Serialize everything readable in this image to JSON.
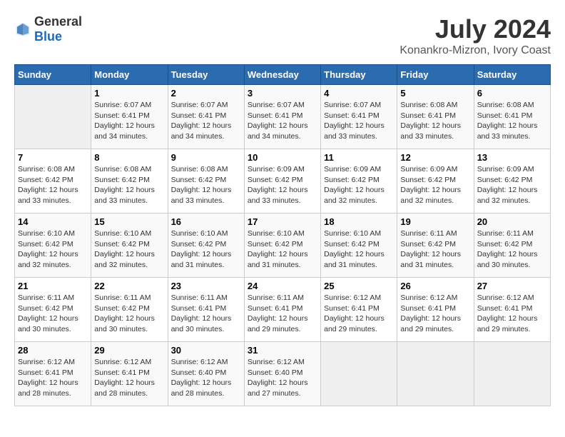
{
  "header": {
    "logo_general": "General",
    "logo_blue": "Blue",
    "month_year": "July 2024",
    "location": "Konankro-Mizron, Ivory Coast"
  },
  "weekdays": [
    "Sunday",
    "Monday",
    "Tuesday",
    "Wednesday",
    "Thursday",
    "Friday",
    "Saturday"
  ],
  "weeks": [
    [
      {
        "day": "",
        "sunrise": "",
        "sunset": "",
        "daylight": ""
      },
      {
        "day": "1",
        "sunrise": "Sunrise: 6:07 AM",
        "sunset": "Sunset: 6:41 PM",
        "daylight": "Daylight: 12 hours and 34 minutes."
      },
      {
        "day": "2",
        "sunrise": "Sunrise: 6:07 AM",
        "sunset": "Sunset: 6:41 PM",
        "daylight": "Daylight: 12 hours and 34 minutes."
      },
      {
        "day": "3",
        "sunrise": "Sunrise: 6:07 AM",
        "sunset": "Sunset: 6:41 PM",
        "daylight": "Daylight: 12 hours and 34 minutes."
      },
      {
        "day": "4",
        "sunrise": "Sunrise: 6:07 AM",
        "sunset": "Sunset: 6:41 PM",
        "daylight": "Daylight: 12 hours and 33 minutes."
      },
      {
        "day": "5",
        "sunrise": "Sunrise: 6:08 AM",
        "sunset": "Sunset: 6:41 PM",
        "daylight": "Daylight: 12 hours and 33 minutes."
      },
      {
        "day": "6",
        "sunrise": "Sunrise: 6:08 AM",
        "sunset": "Sunset: 6:41 PM",
        "daylight": "Daylight: 12 hours and 33 minutes."
      }
    ],
    [
      {
        "day": "7",
        "sunrise": "Sunrise: 6:08 AM",
        "sunset": "Sunset: 6:42 PM",
        "daylight": "Daylight: 12 hours and 33 minutes."
      },
      {
        "day": "8",
        "sunrise": "Sunrise: 6:08 AM",
        "sunset": "Sunset: 6:42 PM",
        "daylight": "Daylight: 12 hours and 33 minutes."
      },
      {
        "day": "9",
        "sunrise": "Sunrise: 6:08 AM",
        "sunset": "Sunset: 6:42 PM",
        "daylight": "Daylight: 12 hours and 33 minutes."
      },
      {
        "day": "10",
        "sunrise": "Sunrise: 6:09 AM",
        "sunset": "Sunset: 6:42 PM",
        "daylight": "Daylight: 12 hours and 33 minutes."
      },
      {
        "day": "11",
        "sunrise": "Sunrise: 6:09 AM",
        "sunset": "Sunset: 6:42 PM",
        "daylight": "Daylight: 12 hours and 32 minutes."
      },
      {
        "day": "12",
        "sunrise": "Sunrise: 6:09 AM",
        "sunset": "Sunset: 6:42 PM",
        "daylight": "Daylight: 12 hours and 32 minutes."
      },
      {
        "day": "13",
        "sunrise": "Sunrise: 6:09 AM",
        "sunset": "Sunset: 6:42 PM",
        "daylight": "Daylight: 12 hours and 32 minutes."
      }
    ],
    [
      {
        "day": "14",
        "sunrise": "Sunrise: 6:10 AM",
        "sunset": "Sunset: 6:42 PM",
        "daylight": "Daylight: 12 hours and 32 minutes."
      },
      {
        "day": "15",
        "sunrise": "Sunrise: 6:10 AM",
        "sunset": "Sunset: 6:42 PM",
        "daylight": "Daylight: 12 hours and 32 minutes."
      },
      {
        "day": "16",
        "sunrise": "Sunrise: 6:10 AM",
        "sunset": "Sunset: 6:42 PM",
        "daylight": "Daylight: 12 hours and 31 minutes."
      },
      {
        "day": "17",
        "sunrise": "Sunrise: 6:10 AM",
        "sunset": "Sunset: 6:42 PM",
        "daylight": "Daylight: 12 hours and 31 minutes."
      },
      {
        "day": "18",
        "sunrise": "Sunrise: 6:10 AM",
        "sunset": "Sunset: 6:42 PM",
        "daylight": "Daylight: 12 hours and 31 minutes."
      },
      {
        "day": "19",
        "sunrise": "Sunrise: 6:11 AM",
        "sunset": "Sunset: 6:42 PM",
        "daylight": "Daylight: 12 hours and 31 minutes."
      },
      {
        "day": "20",
        "sunrise": "Sunrise: 6:11 AM",
        "sunset": "Sunset: 6:42 PM",
        "daylight": "Daylight: 12 hours and 30 minutes."
      }
    ],
    [
      {
        "day": "21",
        "sunrise": "Sunrise: 6:11 AM",
        "sunset": "Sunset: 6:42 PM",
        "daylight": "Daylight: 12 hours and 30 minutes."
      },
      {
        "day": "22",
        "sunrise": "Sunrise: 6:11 AM",
        "sunset": "Sunset: 6:42 PM",
        "daylight": "Daylight: 12 hours and 30 minutes."
      },
      {
        "day": "23",
        "sunrise": "Sunrise: 6:11 AM",
        "sunset": "Sunset: 6:41 PM",
        "daylight": "Daylight: 12 hours and 30 minutes."
      },
      {
        "day": "24",
        "sunrise": "Sunrise: 6:11 AM",
        "sunset": "Sunset: 6:41 PM",
        "daylight": "Daylight: 12 hours and 29 minutes."
      },
      {
        "day": "25",
        "sunrise": "Sunrise: 6:12 AM",
        "sunset": "Sunset: 6:41 PM",
        "daylight": "Daylight: 12 hours and 29 minutes."
      },
      {
        "day": "26",
        "sunrise": "Sunrise: 6:12 AM",
        "sunset": "Sunset: 6:41 PM",
        "daylight": "Daylight: 12 hours and 29 minutes."
      },
      {
        "day": "27",
        "sunrise": "Sunrise: 6:12 AM",
        "sunset": "Sunset: 6:41 PM",
        "daylight": "Daylight: 12 hours and 29 minutes."
      }
    ],
    [
      {
        "day": "28",
        "sunrise": "Sunrise: 6:12 AM",
        "sunset": "Sunset: 6:41 PM",
        "daylight": "Daylight: 12 hours and 28 minutes."
      },
      {
        "day": "29",
        "sunrise": "Sunrise: 6:12 AM",
        "sunset": "Sunset: 6:41 PM",
        "daylight": "Daylight: 12 hours and 28 minutes."
      },
      {
        "day": "30",
        "sunrise": "Sunrise: 6:12 AM",
        "sunset": "Sunset: 6:40 PM",
        "daylight": "Daylight: 12 hours and 28 minutes."
      },
      {
        "day": "31",
        "sunrise": "Sunrise: 6:12 AM",
        "sunset": "Sunset: 6:40 PM",
        "daylight": "Daylight: 12 hours and 27 minutes."
      },
      {
        "day": "",
        "sunrise": "",
        "sunset": "",
        "daylight": ""
      },
      {
        "day": "",
        "sunrise": "",
        "sunset": "",
        "daylight": ""
      },
      {
        "day": "",
        "sunrise": "",
        "sunset": "",
        "daylight": ""
      }
    ]
  ]
}
